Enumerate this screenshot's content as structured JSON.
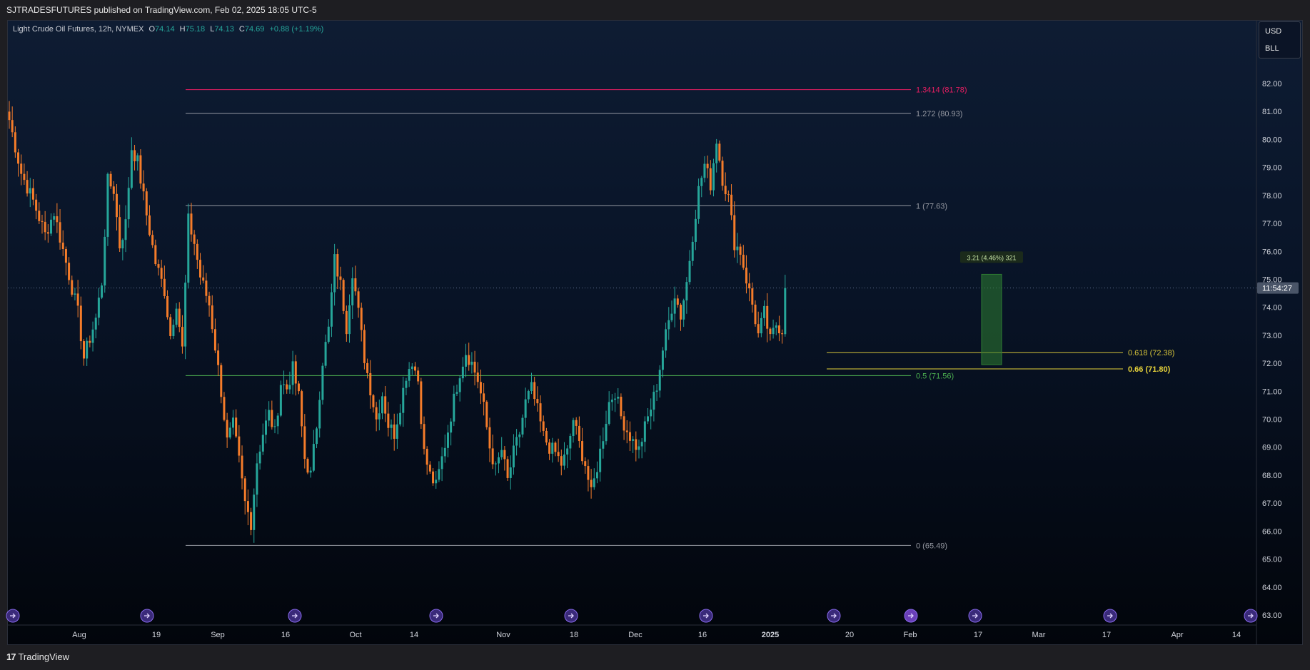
{
  "header": {
    "published": "SJTRADESFUTURES published on TradingView.com, Feb 02, 2025 18:05 UTC-5"
  },
  "symbol": {
    "name": "Light Crude Oil Futures, 12h, NYMEX",
    "o_label": "O",
    "o_value": "74.14",
    "h_label": "H",
    "h_value": "75.18",
    "l_label": "L",
    "l_value": "74.13",
    "c_label": "C",
    "c_value": "74.69",
    "change": "+0.88 (+1.19%)"
  },
  "currency": {
    "unit": "USD",
    "measure": "BLL"
  },
  "footer": {
    "brand": "TradingView",
    "logo_glyph": "17"
  },
  "colors": {
    "up": "#26a69a",
    "down": "#f57c2a",
    "fib_red": "#e91e63",
    "fib_gray": "#9598a1",
    "fib_green": "#4caf50",
    "fib_yellow": "#d4c23a",
    "target_box": "#2e7d32"
  },
  "chart_data": {
    "type": "candlestick",
    "title": "Light Crude Oil Futures, 12h, NYMEX",
    "ylim": [
      62.6,
      83.8
    ],
    "y_ticks": [
      "82.00",
      "81.00",
      "80.00",
      "79.00",
      "78.00",
      "77.00",
      "76.00",
      "75.00",
      "74.00",
      "73.00",
      "72.00",
      "71.00",
      "70.00",
      "69.00",
      "68.00",
      "67.00",
      "66.00",
      "65.00",
      "64.00",
      "63.00"
    ],
    "x_ticks": [
      {
        "label": "Aug",
        "bold": false
      },
      {
        "label": "19",
        "bold": false
      },
      {
        "label": "Sep",
        "bold": false
      },
      {
        "label": "16",
        "bold": false
      },
      {
        "label": "Oct",
        "bold": false
      },
      {
        "label": "14",
        "bold": false
      },
      {
        "label": "Nov",
        "bold": false
      },
      {
        "label": "18",
        "bold": false
      },
      {
        "label": "Dec",
        "bold": false
      },
      {
        "label": "16",
        "bold": false
      },
      {
        "label": "2025",
        "bold": true
      },
      {
        "label": "20",
        "bold": false
      },
      {
        "label": "Feb",
        "bold": false
      },
      {
        "label": "17",
        "bold": false
      },
      {
        "label": "Mar",
        "bold": false
      },
      {
        "label": "17",
        "bold": false
      },
      {
        "label": "Apr",
        "bold": false
      },
      {
        "label": "14",
        "bold": false
      }
    ],
    "current_price": 74.69,
    "countdown": "11:54:27",
    "fib_levels": [
      {
        "label": "1.3414 (81.78)",
        "value": 81.78,
        "color": "#e91e63"
      },
      {
        "label": "1.272 (80.93)",
        "value": 80.93,
        "color": "#9598a1"
      },
      {
        "label": "1 (77.63)",
        "value": 77.63,
        "color": "#9598a1"
      },
      {
        "label": "0.5 (71.56)",
        "value": 71.56,
        "color": "#4caf50"
      },
      {
        "label": "0 (65.49)",
        "value": 65.49,
        "color": "#9598a1"
      }
    ],
    "fib_levels_right": [
      {
        "label": "0.618 (72.38)",
        "value": 72.38,
        "color": "#d4c23a",
        "bold": false
      },
      {
        "label": "0.66 (71.80)",
        "value": 71.8,
        "color": "#e6d23a",
        "bold": true
      }
    ],
    "measure": {
      "label": "3.21 (4.46%) 321",
      "from": 71.95,
      "to": 75.18
    },
    "waypoints": [
      [
        0,
        80.7
      ],
      [
        4,
        78.8
      ],
      [
        8,
        77.8
      ],
      [
        12,
        76.6
      ],
      [
        15,
        77.4
      ],
      [
        19,
        75.6
      ],
      [
        23,
        73.8
      ],
      [
        25,
        72.2
      ],
      [
        29,
        73.6
      ],
      [
        31,
        74.9
      ],
      [
        33,
        78.5
      ],
      [
        35,
        78.2
      ],
      [
        37,
        76.2
      ],
      [
        39,
        77.0
      ],
      [
        41,
        79.7
      ],
      [
        43,
        79.2
      ],
      [
        46,
        77.3
      ],
      [
        49,
        75.6
      ],
      [
        52,
        74.6
      ],
      [
        54,
        73.0
      ],
      [
        56,
        74.2
      ],
      [
        58,
        72.5
      ],
      [
        60,
        77.1
      ],
      [
        62,
        76.3
      ],
      [
        64,
        75.1
      ],
      [
        67,
        74.1
      ],
      [
        69,
        72.6
      ],
      [
        71,
        71.0
      ],
      [
        73,
        69.2
      ],
      [
        75,
        69.8
      ],
      [
        77,
        68.5
      ],
      [
        79,
        67.0
      ],
      [
        81,
        66.3
      ],
      [
        83,
        68.5
      ],
      [
        85,
        69.5
      ],
      [
        87,
        70.2
      ],
      [
        89,
        69.5
      ],
      [
        91,
        71.3
      ],
      [
        93,
        71.1
      ],
      [
        95,
        71.8
      ],
      [
        97,
        70.8
      ],
      [
        99,
        68.6
      ],
      [
        101,
        68.0
      ],
      [
        103,
        69.8
      ],
      [
        105,
        72.1
      ],
      [
        107,
        73.2
      ],
      [
        109,
        75.7
      ],
      [
        111,
        74.8
      ],
      [
        113,
        73.3
      ],
      [
        115,
        75.3
      ],
      [
        117,
        73.8
      ],
      [
        119,
        72.2
      ],
      [
        121,
        71.1
      ],
      [
        123,
        70.0
      ],
      [
        125,
        70.9
      ],
      [
        127,
        69.8
      ],
      [
        129,
        69.5
      ],
      [
        131,
        70.5
      ],
      [
        133,
        71.6
      ],
      [
        135,
        72.1
      ],
      [
        137,
        71.4
      ],
      [
        139,
        68.8
      ],
      [
        141,
        68.0
      ],
      [
        143,
        67.6
      ],
      [
        145,
        68.6
      ],
      [
        147,
        69.6
      ],
      [
        149,
        70.7
      ],
      [
        151,
        71.7
      ],
      [
        153,
        72.4
      ],
      [
        155,
        72.0
      ],
      [
        157,
        71.4
      ],
      [
        159,
        70.4
      ],
      [
        161,
        69.0
      ],
      [
        163,
        68.2
      ],
      [
        165,
        68.9
      ],
      [
        167,
        67.8
      ],
      [
        169,
        68.8
      ],
      [
        171,
        69.5
      ],
      [
        173,
        70.6
      ],
      [
        175,
        71.1
      ],
      [
        177,
        70.3
      ],
      [
        179,
        69.4
      ],
      [
        181,
        69.0
      ],
      [
        183,
        68.8
      ],
      [
        185,
        68.4
      ],
      [
        187,
        68.8
      ],
      [
        189,
        70.0
      ],
      [
        191,
        69.1
      ],
      [
        193,
        68.4
      ],
      [
        195,
        67.3
      ],
      [
        197,
        68.3
      ],
      [
        199,
        69.4
      ],
      [
        201,
        70.6
      ],
      [
        203,
        71.0
      ],
      [
        205,
        70.1
      ],
      [
        207,
        69.6
      ],
      [
        209,
        69.2
      ],
      [
        211,
        68.9
      ],
      [
        213,
        69.7
      ],
      [
        215,
        70.4
      ],
      [
        217,
        71.2
      ],
      [
        219,
        72.5
      ],
      [
        221,
        73.5
      ],
      [
        223,
        74.5
      ],
      [
        225,
        73.7
      ],
      [
        227,
        74.9
      ],
      [
        229,
        76.6
      ],
      [
        231,
        78.2
      ],
      [
        233,
        79.1
      ],
      [
        235,
        78.4
      ],
      [
        237,
        80.0
      ],
      [
        239,
        78.6
      ],
      [
        241,
        77.9
      ],
      [
        243,
        76.3
      ],
      [
        245,
        76.0
      ],
      [
        247,
        75.0
      ],
      [
        249,
        74.1
      ],
      [
        251,
        73.0
      ],
      [
        253,
        73.8
      ],
      [
        255,
        72.8
      ],
      [
        257,
        73.4
      ],
      [
        259,
        73.2
      ],
      [
        260,
        74.69
      ]
    ]
  }
}
